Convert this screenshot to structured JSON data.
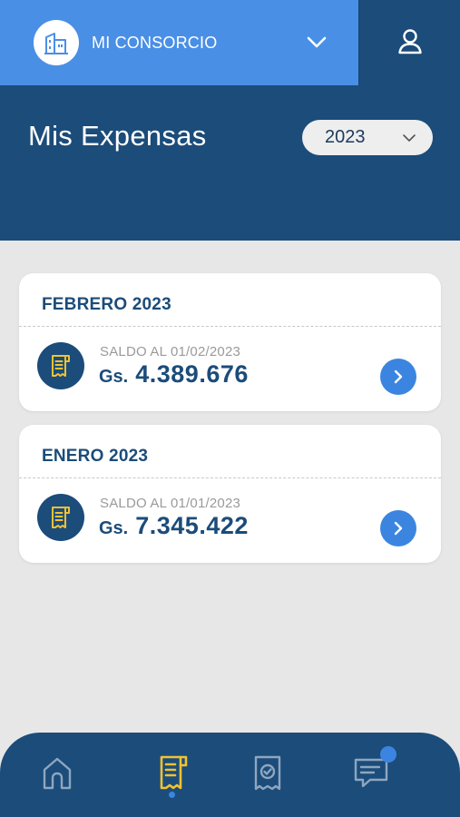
{
  "topbar": {
    "consorcio_name": "MI CONSORCIO",
    "icons": [
      "building-icon",
      "chevron-down-icon",
      "user-icon"
    ]
  },
  "header": {
    "title": "Mis Expensas",
    "year_selected": "2023"
  },
  "expensas": [
    {
      "month": "FEBRERO 2023",
      "saldo_label": "SALDO AL 01/02/2023",
      "currency": "Gs.",
      "amount": "4.389.676"
    },
    {
      "month": "ENERO 2023",
      "saldo_label": "SALDO AL 01/01/2023",
      "currency": "Gs.",
      "amount": "7.345.422"
    }
  ],
  "bottom_nav": {
    "items": [
      "home-icon",
      "receipt-icon",
      "payment-receipt-icon",
      "messages-icon"
    ],
    "active": "receipt-icon",
    "has_notification": "messages-icon"
  },
  "colors": {
    "primary_dark": "#1b4c7a",
    "primary_light": "#4a8fe6",
    "accent": "#3b85e0",
    "active_icon": "#f2c230",
    "background": "#e7e7e7"
  }
}
